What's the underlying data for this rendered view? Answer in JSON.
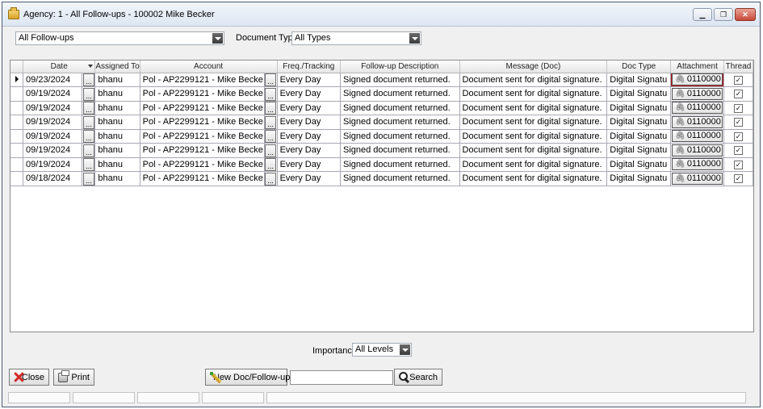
{
  "window": {
    "title": "Agency: 1 - All Follow-ups - 100002 Mike Becker",
    "controls": {
      "minimize": "▁",
      "restore": "❐",
      "close": "✕"
    }
  },
  "filters": {
    "view_value": "All Follow-ups",
    "doc_type_label": "Document Type:",
    "doc_type_value": "All Types",
    "importance_label": "Importance:",
    "importance_value": "All Levels"
  },
  "grid": {
    "columns": [
      "Date",
      "Assigned To",
      "Account",
      "Freq./Tracking",
      "Follow-up Description",
      "Message (Doc)",
      "Doc Type",
      "Attachment",
      "Thread"
    ],
    "ellipsis": "...",
    "check": "✓",
    "rows": [
      {
        "date": "09/23/2024",
        "assigned": "bhanu",
        "account": "Pol - AP2299121 - Mike Becke",
        "freq": "Every Day",
        "description": "Signed document returned.",
        "message": "Document sent for digital signature.",
        "doc_type": "Digital Signatu",
        "attachment": "0110000",
        "thread": true
      },
      {
        "date": "09/19/2024",
        "assigned": "bhanu",
        "account": "Pol - AP2299121 - Mike Becke",
        "freq": "Every Day",
        "description": "Signed document returned.",
        "message": "Document sent for digital signature.",
        "doc_type": "Digital Signatu",
        "attachment": "0110000",
        "thread": true
      },
      {
        "date": "09/19/2024",
        "assigned": "bhanu",
        "account": "Pol - AP2299121 - Mike Becke",
        "freq": "Every Day",
        "description": "Signed document returned.",
        "message": "Document sent for digital signature.",
        "doc_type": "Digital Signatu",
        "attachment": "0110000",
        "thread": true
      },
      {
        "date": "09/19/2024",
        "assigned": "bhanu",
        "account": "Pol - AP2299121 - Mike Becke",
        "freq": "Every Day",
        "description": "Signed document returned.",
        "message": "Document sent for digital signature.",
        "doc_type": "Digital Signatu",
        "attachment": "0110000",
        "thread": true
      },
      {
        "date": "09/19/2024",
        "assigned": "bhanu",
        "account": "Pol - AP2299121 - Mike Becke",
        "freq": "Every Day",
        "description": "Signed document returned.",
        "message": "Document sent for digital signature.",
        "doc_type": "Digital Signatu",
        "attachment": "0110000",
        "thread": true
      },
      {
        "date": "09/19/2024",
        "assigned": "bhanu",
        "account": "Pol - AP2299121 - Mike Becke",
        "freq": "Every Day",
        "description": "Signed document returned.",
        "message": "Document sent for digital signature.",
        "doc_type": "Digital Signatu",
        "attachment": "0110000",
        "thread": true
      },
      {
        "date": "09/19/2024",
        "assigned": "bhanu",
        "account": "Pol - AP2299121 - Mike Becke",
        "freq": "Every Day",
        "description": "Signed document returned.",
        "message": "Document sent for digital signature.",
        "doc_type": "Digital Signatu",
        "attachment": "0110000",
        "thread": true
      },
      {
        "date": "09/18/2024",
        "assigned": "bhanu",
        "account": "Pol - AP2299121 - Mike Becke",
        "freq": "Every Day",
        "description": "Signed document returned.",
        "message": "Document sent for digital signature.",
        "doc_type": "Digital Signatu",
        "attachment": "0110000",
        "thread": true
      }
    ]
  },
  "buttons": {
    "close": "Close",
    "print": "Print",
    "new_doc": "New Doc/Follow-up",
    "search": "Search"
  },
  "search": {
    "value": ""
  },
  "icons": {
    "window": "folder-icon",
    "close": "red-x-icon",
    "print": "printer-icon",
    "new_doc": "pencil-icon",
    "search": "magnifier-icon",
    "attachment": "paperclip-icon",
    "row_selector": "triangle-right-icon"
  },
  "colors": {
    "highlight": "#c0141c"
  }
}
